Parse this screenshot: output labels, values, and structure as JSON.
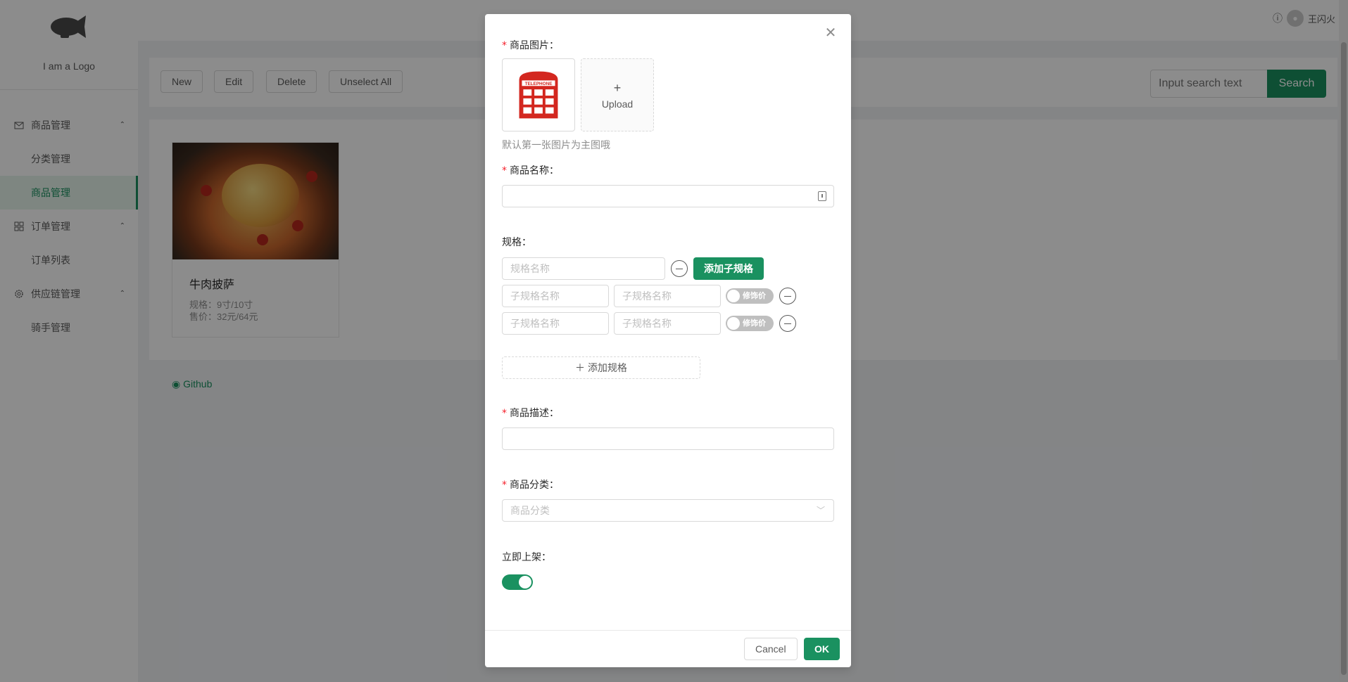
{
  "app": {
    "logo_text": "I am a Logo",
    "user_name": "王闪火"
  },
  "sidebar": {
    "items": [
      {
        "label": "商品管理",
        "type": "group"
      },
      {
        "label": "分类管理",
        "type": "sub"
      },
      {
        "label": "商品管理",
        "type": "sub",
        "active": true
      },
      {
        "label": "订单管理",
        "type": "group"
      },
      {
        "label": "订单列表",
        "type": "sub"
      },
      {
        "label": "供应链管理",
        "type": "group"
      },
      {
        "label": "骑手管理",
        "type": "sub"
      }
    ]
  },
  "toolbar": {
    "new_label": "New",
    "edit_label": "Edit",
    "delete_label": "Delete",
    "unselect_label": "Unselect All",
    "search_placeholder": "Input search text",
    "search_label": "Search"
  },
  "product": {
    "title": "牛肉披萨",
    "spec": "规格：9寸/10寸",
    "price": "售价：32元/64元"
  },
  "footer": {
    "github_label": "Github"
  },
  "modal": {
    "image_label": "商品图片：",
    "upload_label": "Upload",
    "image_hint": "默认第一张图片为主图哦",
    "name_label": "商品名称：",
    "spec_label": "规格：",
    "spec_name_placeholder": "规格名称",
    "add_sub_spec_label": "添加子规格",
    "sub_spec_placeholder": "子规格名称",
    "modifier_price_label": "修饰价",
    "add_spec_label": "添加规格",
    "desc_label": "商品描述：",
    "category_label": "商品分类：",
    "category_placeholder": "商品分类",
    "publish_label": "立即上架：",
    "publish_on": true,
    "cancel_label": "Cancel",
    "ok_label": "OK"
  },
  "colors": {
    "primary": "#1a9160",
    "required": "#f5222d"
  }
}
